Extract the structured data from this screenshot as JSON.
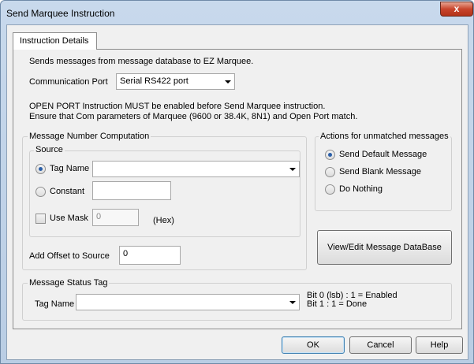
{
  "window": {
    "title": "Send Marquee Instruction",
    "close_label": "x"
  },
  "tabs": [
    {
      "label": "Instruction Details"
    }
  ],
  "description": "Sends messages from message database to EZ Marquee.",
  "communication_port": {
    "label": "Communication Port",
    "value": "Serial RS422 port"
  },
  "notes": {
    "line1": "OPEN PORT Instruction MUST be enabled before Send Marquee instruction.",
    "line2": "Ensure that Com parameters of Marquee (9600 or 38.4K, 8N1) and Open Port match."
  },
  "message_number": {
    "title": "Message Number Computation",
    "source": {
      "title": "Source",
      "tag_name_label": "Tag Name",
      "tag_name_value": "",
      "tag_name_selected": true,
      "constant_label": "Constant",
      "constant_value": "",
      "constant_selected": false,
      "use_mask_label": "Use Mask",
      "use_mask_checked": false,
      "mask_value": "0",
      "hex_label": "(Hex)"
    },
    "offset_label": "Add Offset to Source",
    "offset_value": "0"
  },
  "unmatched_actions": {
    "title": "Actions for unmatched messages",
    "options": [
      {
        "label": "Send Default Message",
        "selected": true
      },
      {
        "label": "Send Blank Message",
        "selected": false
      },
      {
        "label": "Do Nothing",
        "selected": false
      }
    ]
  },
  "view_edit_button": "View/Edit Message DataBase",
  "status_tag": {
    "title": "Message Status Tag",
    "tag_name_label": "Tag Name",
    "tag_name_value": "",
    "bit0": "Bit 0 (lsb) : 1 = Enabled",
    "bit1": "Bit 1 : 1 = Done"
  },
  "buttons": {
    "ok": "OK",
    "cancel": "Cancel",
    "help": "Help"
  }
}
